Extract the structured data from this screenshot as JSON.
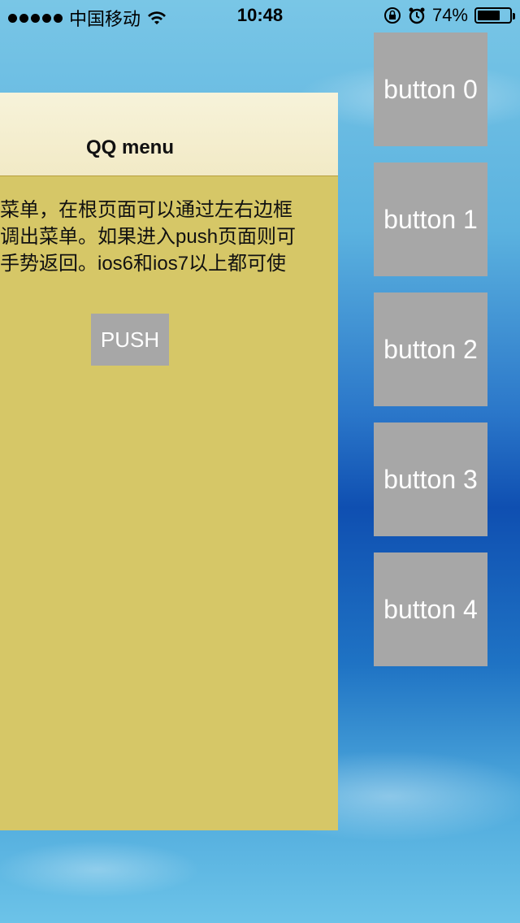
{
  "status_bar": {
    "carrier": "中国移动",
    "time": "10:48",
    "battery_percent": "74%",
    "battery_level": 0.74,
    "icons": [
      "signal-dots-icon",
      "wifi-icon",
      "rotation-lock-icon",
      "alarm-icon",
      "battery-icon"
    ]
  },
  "content": {
    "nav_title": "QQ menu",
    "description_lines": [
      "菜单，在根页面可以通过左右边框",
      "调出菜单。如果进入push页面则可",
      "手势返回。ios6和ios7以上都可使"
    ],
    "push_label": "PUSH"
  },
  "menu": {
    "buttons": [
      "button 0",
      "button 1",
      "button 2",
      "button 3",
      "button 4"
    ]
  },
  "colors": {
    "panel_bg": "#d6c767",
    "nav_bg": "#f2eac6",
    "button_bg": "#a7a7a7",
    "button_text": "#ffffff"
  }
}
